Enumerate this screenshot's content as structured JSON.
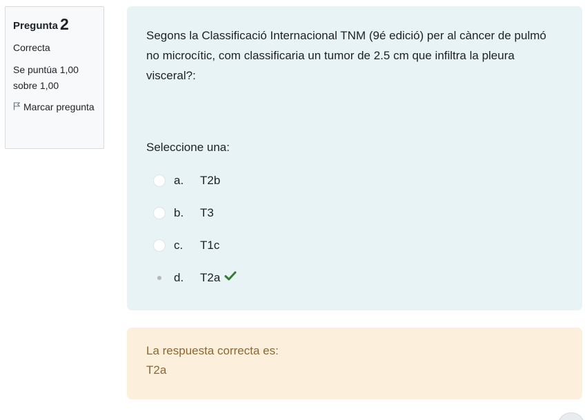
{
  "info": {
    "question_word": "Pregunta",
    "question_number": "2",
    "state": "Correcta",
    "grade": "Se puntúa 1,00 sobre 1,00",
    "flag_label": "Marcar pregunta",
    "flag_icon": "flag-outline-icon"
  },
  "question": {
    "text": "Segons la Classificació Internacional TNM (9é edició) per al càncer de pulmó no microcític, com classificaria un tumor de 2.5 cm que infiltra la pleura visceral?:",
    "prompt": "Seleccione una:",
    "answers": [
      {
        "letter": "a.",
        "text": "T2b",
        "selected": false,
        "correct": false
      },
      {
        "letter": "b.",
        "text": "T3",
        "selected": false,
        "correct": false
      },
      {
        "letter": "c.",
        "text": "T1c",
        "selected": false,
        "correct": false
      },
      {
        "letter": "d.",
        "text": "T2a",
        "selected": true,
        "correct": true
      }
    ]
  },
  "feedback": {
    "label": "La respuesta correcta es:",
    "answer": "T2a"
  },
  "colors": {
    "question_bg": "#e7f3f5",
    "feedback_bg": "#fcefdc",
    "feedback_text": "#8e662e",
    "correct_check": "#357a32"
  }
}
